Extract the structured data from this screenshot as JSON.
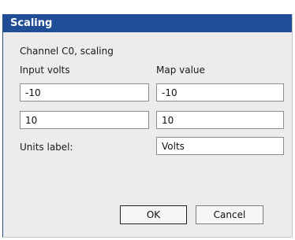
{
  "dialog": {
    "title": "Scaling",
    "subtitle": "Channel C0, scaling",
    "col_input_label": "Input volts",
    "col_map_label": "Map value",
    "rows": [
      {
        "input": "-10",
        "map": "-10"
      },
      {
        "input": "10",
        "map": "10"
      }
    ],
    "units_label": "Units label:",
    "units_value": "Volts",
    "ok_label": "OK",
    "cancel_label": "Cancel"
  },
  "colors": {
    "titlebar": "#1f4e96",
    "dialog_bg": "#ececec"
  }
}
